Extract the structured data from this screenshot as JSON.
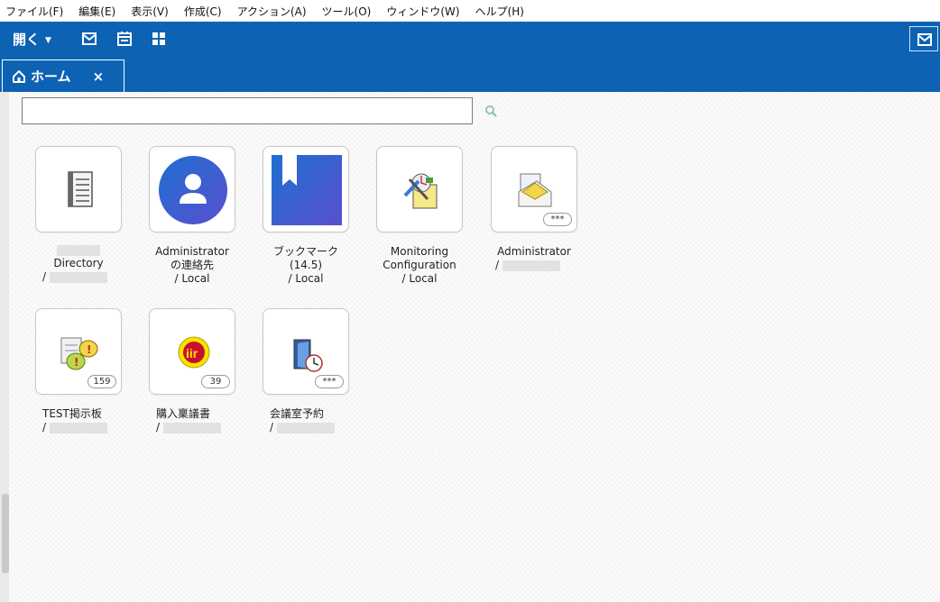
{
  "menu": [
    "ファイル(F)",
    "編集(E)",
    "表示(V)",
    "作成(C)",
    "アクション(A)",
    "ツール(O)",
    "ウィンドウ(W)",
    "ヘルプ(H)"
  ],
  "toolbar": {
    "open_label": "開く",
    "open_caret": "▼"
  },
  "tab": {
    "label": "ホーム",
    "close": "×"
  },
  "search": {
    "value": "",
    "placeholder": ""
  },
  "tiles": [
    {
      "line1": "",
      "line2": "Directory",
      "line3": "/"
    },
    {
      "line1": "Administrator",
      "line2": "の連絡先",
      "line3": "/ Local"
    },
    {
      "line1": "ブックマーク",
      "line2": "(14.5)",
      "line3": "/ Local"
    },
    {
      "line1": "Monitoring",
      "line2": "Configuration",
      "line3": "/ Local"
    },
    {
      "line1": "Administrator",
      "line2": "/",
      "badge": "***"
    },
    {
      "line1": "TEST掲示板",
      "line2": "/",
      "badge": "159"
    },
    {
      "line1": "購入稟議書",
      "line2": "/",
      "badge": "39"
    },
    {
      "line1": "会議室予約",
      "line2": "/",
      "badge": "***"
    }
  ],
  "colors": {
    "brand_blue": "#0d62b3"
  }
}
